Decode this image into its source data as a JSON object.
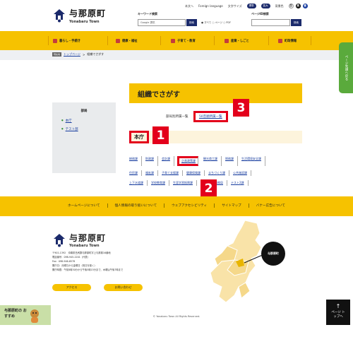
{
  "header": {
    "logo_ja": "与那原町",
    "logo_en": "Yonabaru Town",
    "top_links": [
      "本文へ",
      "Foreign language"
    ],
    "font_size_label": "文字サイズ",
    "font_standard": "標準",
    "font_large": "拡大",
    "bg_color_label": "背景色",
    "bg_options": [
      "白",
      "黒",
      "青"
    ],
    "keyword_label": "キーワード検索",
    "keyword_placeholder": "Google 提供",
    "search_button": "検索",
    "keyword_options": "● すべて ○ ページ ○ PDF",
    "page_id_label": "ページID検索",
    "page_id_button": "検索"
  },
  "nav": {
    "items": [
      "暮らし・手続き",
      "健康・福祉",
      "子育て・教育",
      "産業・しごと",
      "町政情報"
    ]
  },
  "breadcrumb": {
    "here": "現在地",
    "items": [
      "トップページ",
      "組織でさがす"
    ]
  },
  "sidebar": {
    "heading": "部局",
    "items": [
      "本庁",
      "テスト部"
    ]
  },
  "main": {
    "title": "組織でさがす",
    "sublink_plain": "部局別所属一覧",
    "sublink_highlighted": "50音順所属一覧",
    "section_title": "本庁",
    "dept_rows": [
      [
        "総務課",
        "財政課",
        "会計課",
        "企画政策課",
        "観光商工課",
        "税務課",
        "生活環境安全課"
      ],
      [
        "住民課",
        "福祉課",
        "子育て支援課",
        "健康保険課",
        "まちづくり課",
        "公共施設課"
      ],
      [
        "上下水道課",
        "学校教育課",
        "生涯学習振興課",
        "農業委員会事務局",
        "テスト2課"
      ]
    ]
  },
  "annotations": {
    "badge_1": "1",
    "badge_2": "2",
    "badge_3": "3"
  },
  "footer": {
    "links": [
      "ホームページについて",
      "個人情報の取り扱いについて",
      "ウェブアクセシビリティ",
      "サイトマップ",
      "バナー広告について"
    ],
    "address_lines": [
      "〒901-1392　沖縄県島尻郡与那原町字上与那原16番地",
      "電話番号：098-945-2201（代表）",
      "Fax：098-946-6578",
      "開庁日：月曜日から金曜日（祝日を除く）",
      "開庁時間：午前8時30分から午後5時15分まで、木曜は午後7時まで"
    ],
    "access_button": "アクセス",
    "contact_button": "お問い合わせ",
    "map_callout": "与那原町",
    "copyright": "© Yonabaru Town All Rights Reserved."
  },
  "floating": {
    "side_tab": "ページ先頭へ戻る",
    "recommend": "与那原町の おすすめ",
    "page_top": "ページ トップへ"
  },
  "colors": {
    "accent_yellow": "#f6c200",
    "navy": "#1b2a6b",
    "highlight_red": "#e3001b",
    "green": "#5aaa3c"
  }
}
